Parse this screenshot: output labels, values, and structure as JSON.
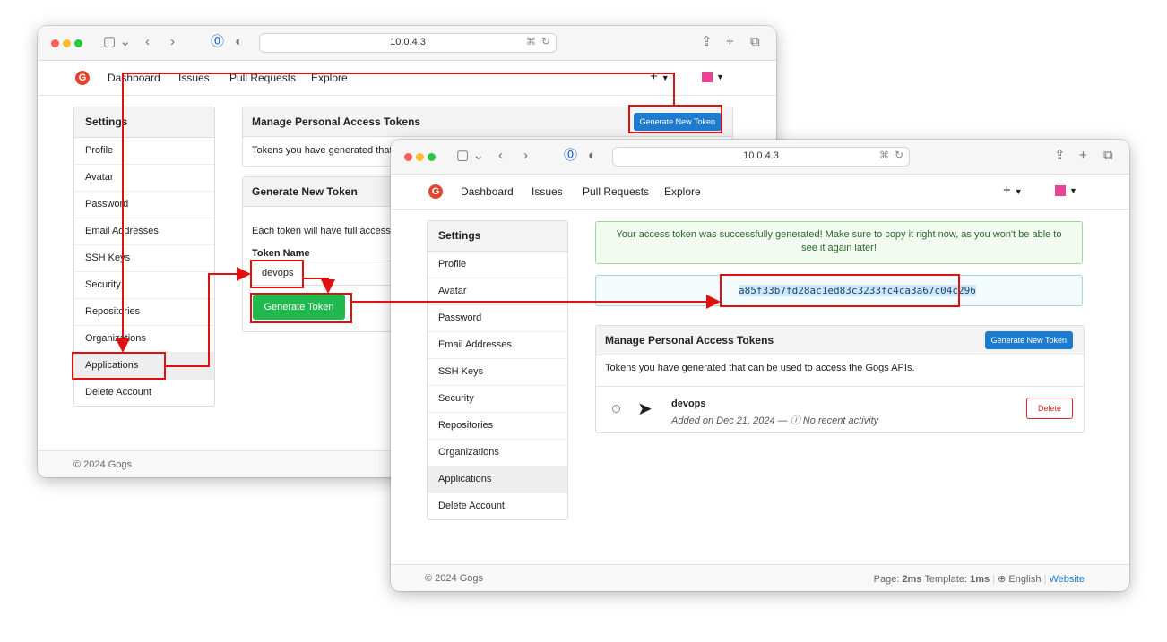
{
  "browser": {
    "url": "10.0.4.3"
  },
  "nav": {
    "dashboard": "Dashboard",
    "issues": "Issues",
    "pull_requests": "Pull Requests",
    "explore": "Explore"
  },
  "sidebar": {
    "title": "Settings",
    "items": [
      "Profile",
      "Avatar",
      "Password",
      "Email Addresses",
      "SSH Keys",
      "Security",
      "Repositories",
      "Organizations",
      "Applications",
      "Delete Account"
    ]
  },
  "window1": {
    "manage_title": "Manage Personal Access Tokens",
    "generate_new_token_button": "Generate New Token",
    "tokens_text": "Tokens you have generated that c",
    "generate_title": "Generate New Token",
    "each_token_text": "Each token will have full access t",
    "token_name_label": "Token Name",
    "token_name_value": "devops",
    "generate_token_button": "Generate Token",
    "footer": "© 2024 Gogs"
  },
  "window2": {
    "success_message": "Your access token was successfully generated! Make sure to copy it right now, as you won't be able to see it again later!",
    "token_value": "a85f33b7fd28ac1ed83c3233fc4ca3a67c04c296",
    "manage_title": "Manage Personal Access Tokens",
    "generate_new_token_button": "Generate New Token",
    "tokens_text": "Tokens you have generated that can be used to access the Gogs APIs.",
    "token_entry": {
      "name": "devops",
      "meta": "Added on Dec 21, 2024 — ⓘ No recent activity",
      "delete_button": "Delete"
    },
    "footer": {
      "copyright": "© 2024 Gogs",
      "page_label": "Page:",
      "page_time": "2ms",
      "template_label": "Template:",
      "template_time": "1ms",
      "language": "English",
      "website": "Website"
    }
  },
  "colors": {
    "annotation": "#e01010",
    "primary": "#1d7ccf",
    "success": "#21b84e"
  }
}
